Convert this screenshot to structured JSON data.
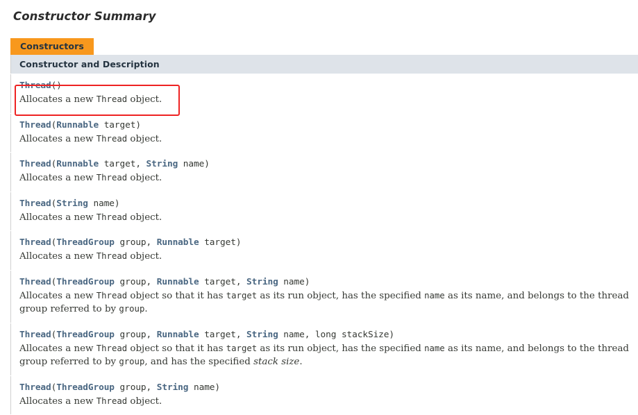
{
  "page": {
    "section_title": "Constructor Summary",
    "caption_tab": "Constructors",
    "column_header": "Constructor and Description"
  },
  "colors": {
    "tab_orange": "#f8981d",
    "header_bg": "#dee3e9",
    "alt_row_bg": "#eeeeee",
    "row_bg": "#ffffff",
    "link_blue": "#4a6782",
    "text": "#353833",
    "annotation_red": "#ee2222"
  },
  "annotation": {
    "name": "red-highlight-box",
    "target_row_index": 0
  },
  "rows": [
    {
      "sig": {
        "name": "Thread",
        "parts": [
          {
            "t": "punct",
            "v": "("
          },
          {
            "t": "punct",
            "v": ")"
          }
        ]
      },
      "desc": [
        {
          "t": "text",
          "v": "Allocates a new "
        },
        {
          "t": "code",
          "v": "Thread"
        },
        {
          "t": "text",
          "v": " object."
        }
      ],
      "shaded": false,
      "highlighted": true
    },
    {
      "sig": {
        "name": "Thread",
        "parts": [
          {
            "t": "punct",
            "v": "("
          },
          {
            "t": "type",
            "v": "Runnable"
          },
          {
            "t": "pname",
            "v": " target"
          },
          {
            "t": "punct",
            "v": ")"
          }
        ]
      },
      "desc": [
        {
          "t": "text",
          "v": "Allocates a new "
        },
        {
          "t": "code",
          "v": "Thread"
        },
        {
          "t": "text",
          "v": " object."
        }
      ],
      "shaded": true,
      "highlighted": false
    },
    {
      "sig": {
        "name": "Thread",
        "parts": [
          {
            "t": "punct",
            "v": "("
          },
          {
            "t": "type",
            "v": "Runnable"
          },
          {
            "t": "pname",
            "v": " target, "
          },
          {
            "t": "type",
            "v": "String"
          },
          {
            "t": "pname",
            "v": " name"
          },
          {
            "t": "punct",
            "v": ")"
          }
        ]
      },
      "desc": [
        {
          "t": "text",
          "v": "Allocates a new "
        },
        {
          "t": "code",
          "v": "Thread"
        },
        {
          "t": "text",
          "v": " object."
        }
      ],
      "shaded": false,
      "highlighted": false
    },
    {
      "sig": {
        "name": "Thread",
        "parts": [
          {
            "t": "punct",
            "v": "("
          },
          {
            "t": "type",
            "v": "String"
          },
          {
            "t": "pname",
            "v": " name"
          },
          {
            "t": "punct",
            "v": ")"
          }
        ]
      },
      "desc": [
        {
          "t": "text",
          "v": "Allocates a new "
        },
        {
          "t": "code",
          "v": "Thread"
        },
        {
          "t": "text",
          "v": " object."
        }
      ],
      "shaded": true,
      "highlighted": false
    },
    {
      "sig": {
        "name": "Thread",
        "parts": [
          {
            "t": "punct",
            "v": "("
          },
          {
            "t": "type",
            "v": "ThreadGroup"
          },
          {
            "t": "pname",
            "v": " group, "
          },
          {
            "t": "type",
            "v": "Runnable"
          },
          {
            "t": "pname",
            "v": " target"
          },
          {
            "t": "punct",
            "v": ")"
          }
        ]
      },
      "desc": [
        {
          "t": "text",
          "v": "Allocates a new "
        },
        {
          "t": "code",
          "v": "Thread"
        },
        {
          "t": "text",
          "v": " object."
        }
      ],
      "shaded": false,
      "highlighted": false
    },
    {
      "sig": {
        "name": "Thread",
        "parts": [
          {
            "t": "punct",
            "v": "("
          },
          {
            "t": "type",
            "v": "ThreadGroup"
          },
          {
            "t": "pname",
            "v": " group, "
          },
          {
            "t": "type",
            "v": "Runnable"
          },
          {
            "t": "pname",
            "v": " target, "
          },
          {
            "t": "type",
            "v": "String"
          },
          {
            "t": "pname",
            "v": " name"
          },
          {
            "t": "punct",
            "v": ")"
          }
        ]
      },
      "desc": [
        {
          "t": "text",
          "v": "Allocates a new "
        },
        {
          "t": "code",
          "v": "Thread"
        },
        {
          "t": "text",
          "v": " object so that it has "
        },
        {
          "t": "code",
          "v": "target"
        },
        {
          "t": "text",
          "v": " as its run object, has the specified "
        },
        {
          "t": "code",
          "v": "name"
        },
        {
          "t": "text",
          "v": " as its name, and belongs to the thread group referred to by "
        },
        {
          "t": "code",
          "v": "group"
        },
        {
          "t": "text",
          "v": "."
        }
      ],
      "shaded": true,
      "highlighted": false
    },
    {
      "sig": {
        "name": "Thread",
        "parts": [
          {
            "t": "punct",
            "v": "("
          },
          {
            "t": "type",
            "v": "ThreadGroup"
          },
          {
            "t": "pname",
            "v": " group, "
          },
          {
            "t": "type",
            "v": "Runnable"
          },
          {
            "t": "pname",
            "v": " target, "
          },
          {
            "t": "type",
            "v": "String"
          },
          {
            "t": "pname",
            "v": " name, long stackSize"
          },
          {
            "t": "punct",
            "v": ")"
          }
        ]
      },
      "desc": [
        {
          "t": "text",
          "v": "Allocates a new "
        },
        {
          "t": "code",
          "v": "Thread"
        },
        {
          "t": "text",
          "v": " object so that it has "
        },
        {
          "t": "code",
          "v": "target"
        },
        {
          "t": "text",
          "v": " as its run object, has the specified "
        },
        {
          "t": "code",
          "v": "name"
        },
        {
          "t": "text",
          "v": " as its name, and belongs to the thread group referred to by "
        },
        {
          "t": "code",
          "v": "group"
        },
        {
          "t": "text",
          "v": ", and has the specified "
        },
        {
          "t": "ital",
          "v": "stack size"
        },
        {
          "t": "text",
          "v": "."
        }
      ],
      "shaded": false,
      "highlighted": false
    },
    {
      "sig": {
        "name": "Thread",
        "parts": [
          {
            "t": "punct",
            "v": "("
          },
          {
            "t": "type",
            "v": "ThreadGroup"
          },
          {
            "t": "pname",
            "v": " group, "
          },
          {
            "t": "type",
            "v": "String"
          },
          {
            "t": "pname",
            "v": " name"
          },
          {
            "t": "punct",
            "v": ")"
          }
        ]
      },
      "desc": [
        {
          "t": "text",
          "v": "Allocates a new "
        },
        {
          "t": "code",
          "v": "Thread"
        },
        {
          "t": "text",
          "v": " object."
        }
      ],
      "shaded": true,
      "highlighted": false
    }
  ]
}
